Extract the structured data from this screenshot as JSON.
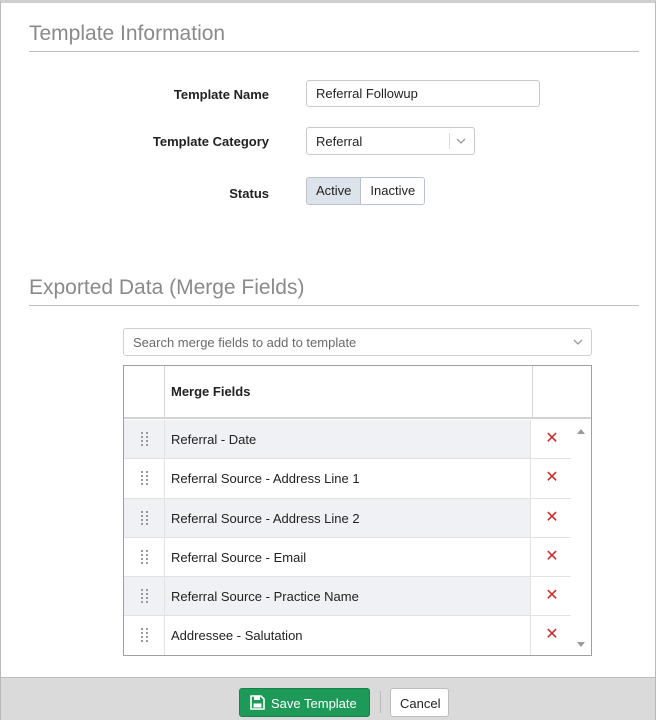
{
  "template_info": {
    "title": "Template Information",
    "name_label": "Template Name",
    "name_value": "Referral Followup",
    "category_label": "Template Category",
    "category_value": "Referral",
    "status_label": "Status",
    "status_options": [
      "Active",
      "Inactive"
    ],
    "status_selected": "Active"
  },
  "merge_section": {
    "title": "Exported Data (Merge Fields)",
    "search_placeholder": "Search merge fields to add to template",
    "column_header": "Merge Fields",
    "rows": [
      {
        "label": "Referral - Date"
      },
      {
        "label": "Referral Source - Address Line 1"
      },
      {
        "label": "Referral Source - Address Line 2"
      },
      {
        "label": "Referral Source - Email"
      },
      {
        "label": "Referral Source - Practice Name"
      },
      {
        "label": "Addressee - Salutation"
      }
    ],
    "remove_glyph": "✕"
  },
  "footer": {
    "save_label": "Save Template",
    "cancel_label": "Cancel"
  },
  "colors": {
    "accent_green": "#1e9a58",
    "remove_red": "#cc2b2b",
    "active_toggle": "#dde3ea"
  },
  "icons": {
    "save": "floppy-disk-icon",
    "drag": "drag-handle-icon",
    "remove": "close-icon",
    "dropdown": "chevron-down-icon"
  }
}
